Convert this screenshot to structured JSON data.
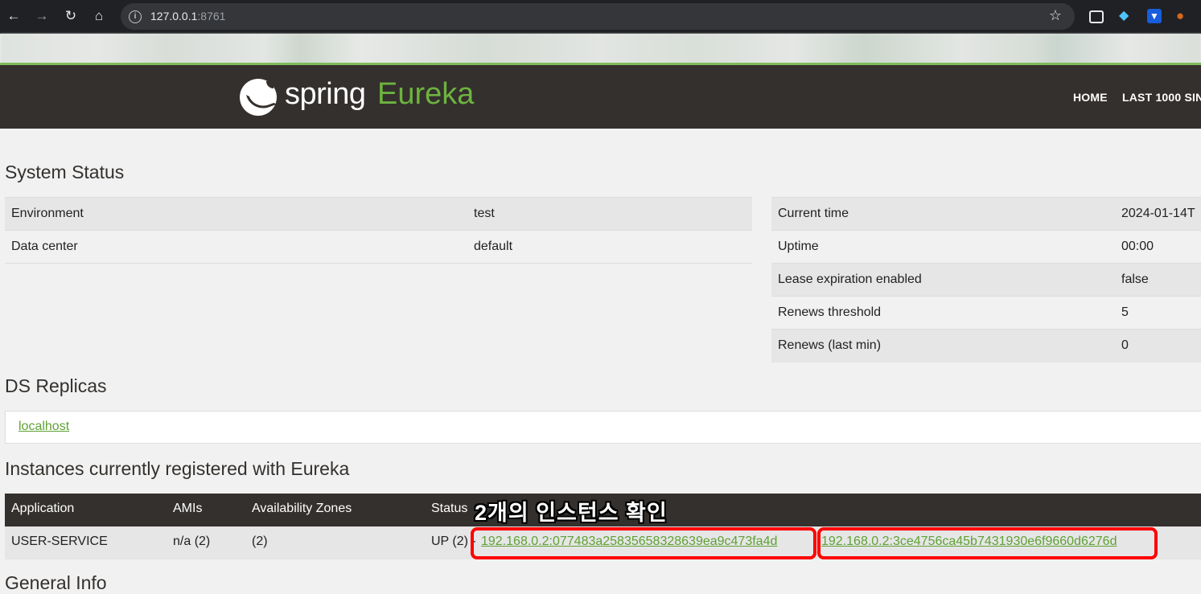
{
  "browser": {
    "url_host": "127.0.0.1",
    "url_port": ":8761",
    "icons": [
      "back-icon",
      "forward-icon",
      "reload-icon",
      "home-icon",
      "site-info-icon",
      "bookmark-star-icon",
      "tab-search-icon",
      "diamond-extension-icon",
      "bitwarden-extension-icon",
      "cookie-extension-icon"
    ]
  },
  "header": {
    "logo_spring": "spring",
    "logo_eureka": "Eureka",
    "nav": [
      "HOME",
      "LAST 1000 SIN"
    ]
  },
  "system_status": {
    "title": "System Status",
    "left": [
      {
        "label": "Environment",
        "value": "test"
      },
      {
        "label": "Data center",
        "value": "default"
      }
    ],
    "right": [
      {
        "label": "Current time",
        "value": "2024-01-14T"
      },
      {
        "label": "Uptime",
        "value": "00:00"
      },
      {
        "label": "Lease expiration enabled",
        "value": "false"
      },
      {
        "label": "Renews threshold",
        "value": "5"
      },
      {
        "label": "Renews (last min)",
        "value": "0"
      }
    ]
  },
  "ds_replicas": {
    "title": "DS Replicas",
    "items": [
      "localhost"
    ]
  },
  "instances": {
    "title": "Instances currently registered with Eureka",
    "headers": [
      "Application",
      "AMIs",
      "Availability Zones",
      "Status"
    ],
    "rows": [
      {
        "application": "USER-SERVICE",
        "amis": "n/a (2)",
        "zones": "(2)",
        "status": "UP (2) -",
        "links": [
          "192.168.0.2:077483a25835658328639ea9c473fa4d",
          "192.168.0.2:3ce4756ca45b7431930e6f9660d6276d"
        ]
      }
    ],
    "annotation": "2개의 인스턴스 확인"
  },
  "general_info": {
    "title": "General Info"
  },
  "colors": {
    "header_bg": "#34302d",
    "spring_green": "#6db33f",
    "link_green": "#5fa134",
    "highlight_red": "#ff0000"
  }
}
